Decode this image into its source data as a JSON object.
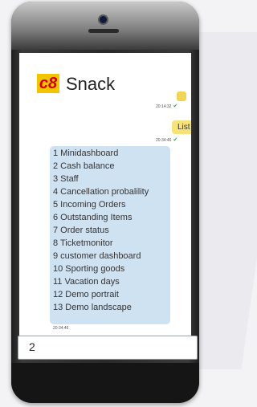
{
  "app": {
    "logo_text": "c8",
    "title": "Snack",
    "logo_colors": {
      "bg": "#f2c400",
      "fg": "#d10000"
    }
  },
  "chat": {
    "timestamp_1": "20:14:32",
    "timestamp_2": "20:34:46",
    "timestamp_3": "20:34:46",
    "user_message": "List",
    "menu_items": [
      "1 Minidashboard",
      "2 Cash balance",
      "3 Staff",
      "4 Cancellation probalility",
      "5 Incoming Orders",
      "6 Outstanding Items",
      "7 Order status",
      "8 Ticketmonitor",
      "9 customer dashboard",
      "10 Sporting goods",
      "11 Vacation days",
      "12 Demo portrait",
      "13 Demo landscape"
    ],
    "bubble_colors": {
      "user": "#f6e27a",
      "bot": "#cfe2f2"
    }
  },
  "input": {
    "value": "2"
  }
}
